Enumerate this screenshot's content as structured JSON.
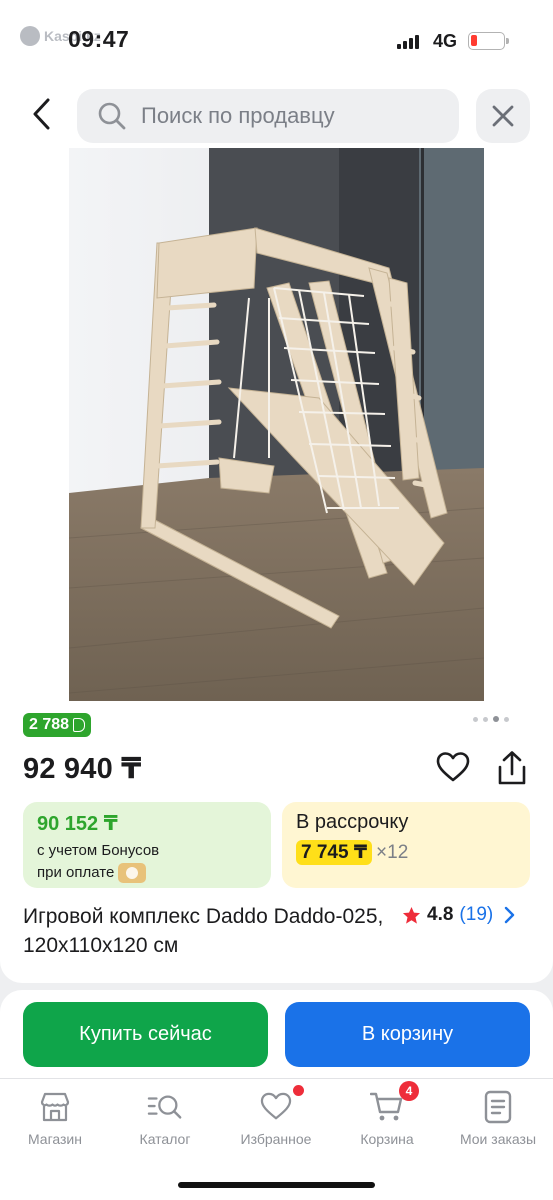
{
  "status_bar": {
    "brand": "Kaspi.kz",
    "time": "09:47",
    "network": "4G"
  },
  "header": {
    "search_placeholder": "Поиск по продавцу"
  },
  "product": {
    "image_alt": "",
    "gallery": {
      "count": 4,
      "active_index": 2
    },
    "bonus": "2 788",
    "price": "92 940 ₸",
    "bonus_price": {
      "value": "90 152 ₸",
      "line1": "с учетом Бонусов",
      "line2": "при оплате"
    },
    "installment": {
      "label": "В рассрочку",
      "amount": "7 745 ₸",
      "multiplier": "×12"
    },
    "title": "Игровой комплекс Daddo Daddo-025, 120x110x120 см",
    "rating": {
      "value": "4.8",
      "count": "(19)"
    }
  },
  "actions": {
    "buy_now": "Купить сейчас",
    "add_to_cart": "В корзину"
  },
  "tabbar": {
    "items": [
      {
        "label": "Магазин",
        "icon": "shop-icon"
      },
      {
        "label": "Каталог",
        "icon": "catalog-search-icon"
      },
      {
        "label": "Избранное",
        "icon": "heart-icon",
        "dot": true
      },
      {
        "label": "Корзина",
        "icon": "cart-icon",
        "badge": "4"
      },
      {
        "label": "Мои заказы",
        "icon": "orders-icon"
      }
    ]
  },
  "colors": {
    "green": "#2ea52d",
    "buy_button": "#0fa54a",
    "cart_button": "#1a72e8",
    "installment_highlight": "#ffdf19",
    "badge_red": "#ee2d3a"
  }
}
